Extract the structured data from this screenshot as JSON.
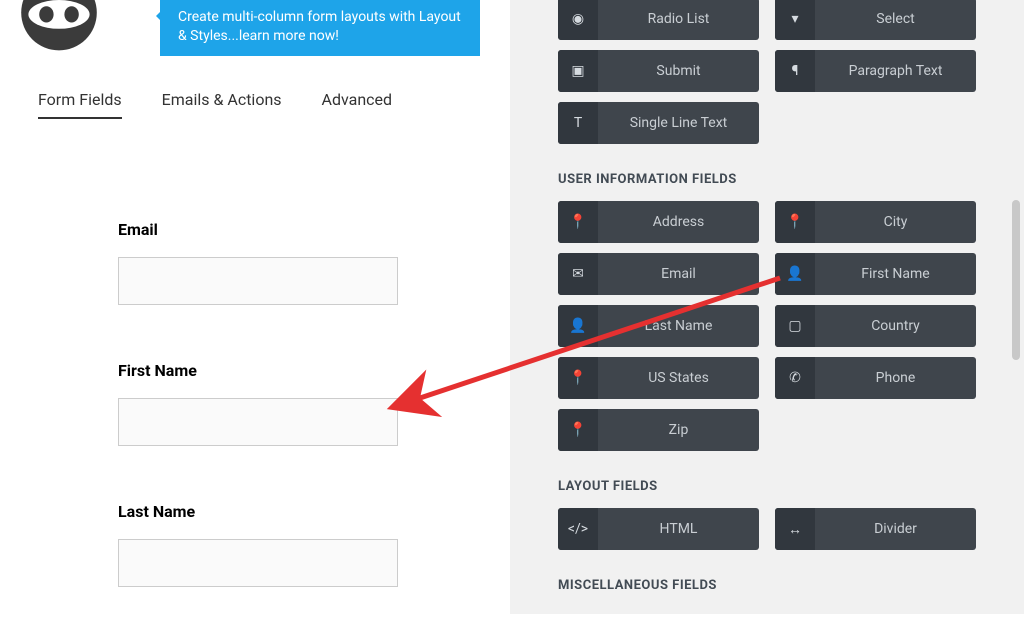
{
  "promo": "Create multi-column form layouts with Layout & Styles...learn more now!",
  "tabs": {
    "form_fields": "Form Fields",
    "emails_actions": "Emails & Actions",
    "advanced": "Advanced"
  },
  "form": {
    "fields": [
      {
        "label": "Email"
      },
      {
        "label": "First Name"
      },
      {
        "label": "Last Name"
      }
    ]
  },
  "palette": {
    "common_top": [
      {
        "icon": "◉",
        "label": "Radio List"
      },
      {
        "icon": "▾",
        "label": "Select"
      },
      {
        "icon": "▣",
        "label": "Submit"
      },
      {
        "icon": "¶",
        "label": "Paragraph Text"
      },
      {
        "icon": "T",
        "label": "Single Line Text"
      }
    ],
    "user_info_title": "USER INFORMATION FIELDS",
    "user_info": [
      {
        "icon": "📍",
        "label": "Address"
      },
      {
        "icon": "📍",
        "label": "City"
      },
      {
        "icon": "✉",
        "label": "Email"
      },
      {
        "icon": "👤",
        "label": "First Name"
      },
      {
        "icon": "👤",
        "label": "Last Name"
      },
      {
        "icon": "▢",
        "label": "Country"
      },
      {
        "icon": "📍",
        "label": "US States"
      },
      {
        "icon": "✆",
        "label": "Phone"
      },
      {
        "icon": "📍",
        "label": "Zip"
      }
    ],
    "layout_title": "LAYOUT FIELDS",
    "layout": [
      {
        "icon": "</>",
        "label": "HTML"
      },
      {
        "icon": "↔",
        "label": "Divider"
      }
    ],
    "misc_title": "MISCELLANEOUS FIELDS"
  }
}
